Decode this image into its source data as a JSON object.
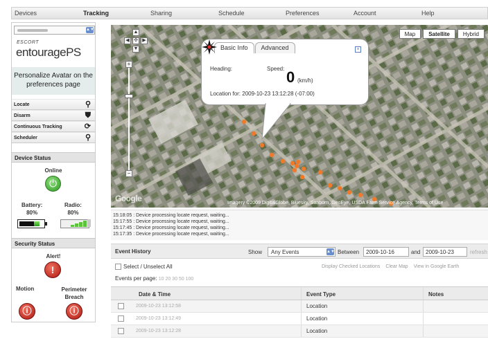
{
  "nav": {
    "items": [
      "Devices",
      "Tracking",
      "Sharing",
      "Schedule",
      "Preferences",
      "Account",
      "Help"
    ],
    "active": "Tracking"
  },
  "sidebar": {
    "device_selector_value": "",
    "logo_small": "ESCORT",
    "logo_big": "entouragePS",
    "avatar_prompt": "Personalize Avatar on the preferences page",
    "commands": [
      {
        "label": "Locate",
        "icon": "magnifier-icon"
      },
      {
        "label": "Disarm",
        "icon": "shield-icon"
      },
      {
        "label": "Continuous Tracking",
        "icon": "magnifier-refresh-icon"
      },
      {
        "label": "Scheduler",
        "icon": "magnifier-icon"
      }
    ],
    "device_status": {
      "heading": "Device Status",
      "online_label": "Online",
      "battery_label": "Battery:",
      "battery_value": "80%",
      "radio_label": "Radio:",
      "radio_value": "80%",
      "battery_level": 0.8,
      "radio_level": 0.8
    },
    "security_status": {
      "heading": "Security Status",
      "alert_label": "Alert!",
      "motion_label": "Motion",
      "perimeter_label": "Perimeter Breach"
    }
  },
  "map": {
    "types": [
      "Map",
      "Satellite",
      "Hybrid"
    ],
    "selected_type": "Satellite",
    "logo": "Google",
    "credit": "Imagery ©2009 DigitalGlobe, Bluesky, Sanborn, GeoEye, USDA Farm Service Agency, Terms of Use",
    "info_window": {
      "tabs": [
        "Basic Info",
        "Advanced"
      ],
      "selected_tab": "Basic Info",
      "close": "×",
      "heading_label": "Heading:",
      "speed_label": "Speed:",
      "speed_value": "0",
      "speed_unit": "(km/h)",
      "location_text": "Location for: 2009-10-23 13:12:28 (-07:00)"
    },
    "track_color": "#f07a2a"
  },
  "log": {
    "lines": [
      "15:18:05 : Device processing locate request, waiting...",
      "15:17:55 : Device processing locate request, waiting...",
      "15:17:45 : Device processing locate request, waiting...",
      "15:17:35 : Device processing locate request, waiting..."
    ]
  },
  "events": {
    "title": "Event History",
    "show_label": "Show",
    "show_value": "Any Events",
    "between_label": "Between",
    "date_from": "2009-10-16",
    "and_label": "and",
    "date_to": "2009-10-23",
    "refresh_label": "refresh",
    "select_all_label": "Select / Unselect All",
    "actions": [
      "Display Checked Locations",
      "Clear Map",
      "View in Google Earth"
    ],
    "per_page_label": "Events per page:",
    "per_page_options": "10 20 30 50 100",
    "columns": [
      "Date & Time",
      "Event Type",
      "Notes"
    ],
    "rows": [
      {
        "datetime": "2009-10-23 13:12:58",
        "type": "Location"
      },
      {
        "datetime": "2009-10-23 13:12:49",
        "type": "Location"
      },
      {
        "datetime": "2009-10-23 13:12:28",
        "type": "Location"
      }
    ]
  }
}
